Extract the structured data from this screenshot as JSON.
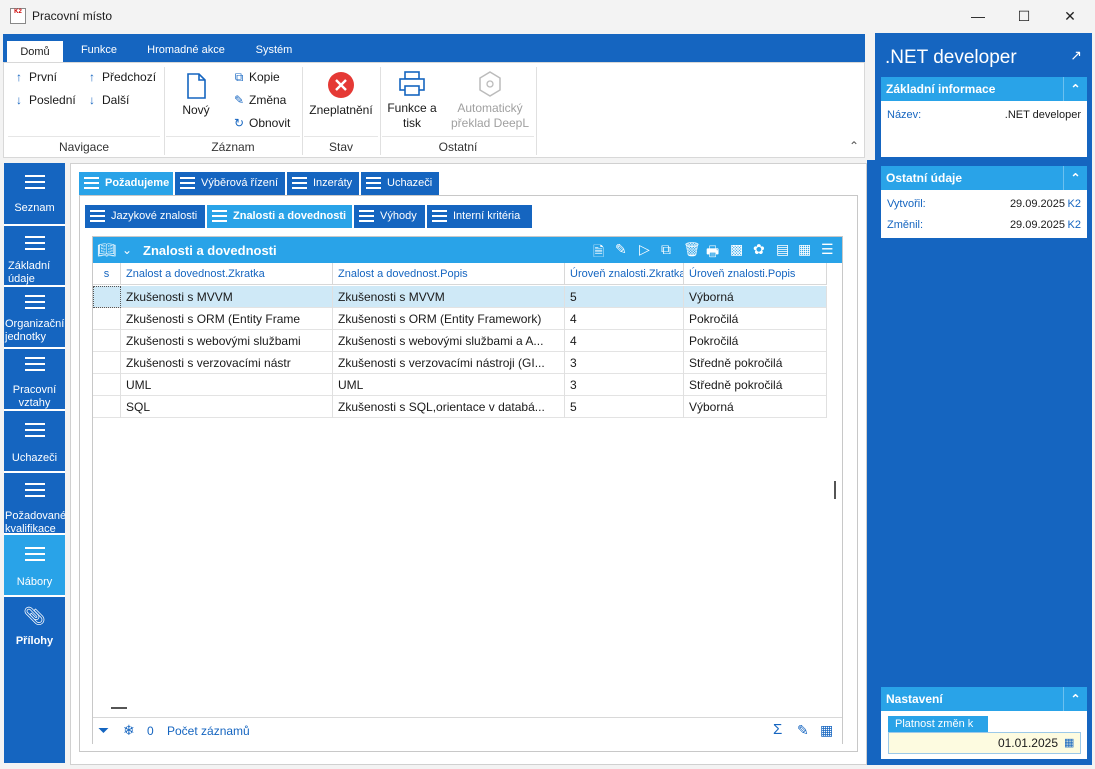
{
  "window": {
    "title": "Pracovní místo",
    "icon_text": "K2"
  },
  "ribbon": {
    "tabs": [
      "Domů",
      "Funkce",
      "Hromadné akce",
      "Systém"
    ],
    "nav": {
      "prvni": "První",
      "posledni": "Poslední",
      "predchozi": "Předchozí",
      "dalsi": "Další",
      "group": "Navigace"
    },
    "zaznam": {
      "novy": "Nový",
      "kopie": "Kopie",
      "zmena": "Změna",
      "obnovit": "Obnovit",
      "group": "Záznam"
    },
    "stav": {
      "zneplatneni": "Zneplatnění",
      "group": "Stav"
    },
    "ostatni": {
      "funkce_tisk_1": "Funkce a",
      "funkce_tisk_2": "tisk",
      "deepl_1": "Automatický",
      "deepl_2": "překlad DeepL",
      "group": "Ostatní"
    }
  },
  "leftnav": [
    {
      "label": "Seznam",
      "active": false
    },
    {
      "label": "Základní údaje",
      "active": false
    },
    {
      "label": "Organizační jednotky",
      "active": false
    },
    {
      "label": "Pracovní vztahy",
      "active": false
    },
    {
      "label": "Uchazeči",
      "active": false
    },
    {
      "label": "Požadované kvalifikace",
      "active": false
    },
    {
      "label": "Nábory",
      "active": true
    },
    {
      "label": "Přílohy",
      "active": false
    }
  ],
  "tabs_level1": [
    "Požadujeme",
    "Výběrová řízení",
    "Inzeráty",
    "Uchazeči"
  ],
  "tabs_level2": [
    "Jazykové znalosti",
    "Znalosti a dovednosti",
    "Výhody",
    "Interní kritéria"
  ],
  "grid": {
    "title": "Znalosti a dovednosti",
    "columns": [
      "s",
      "Znalost a dovednost.Zkratka",
      "Znalost a dovednost.Popis",
      "Úroveň znalosti.Zkratka",
      "Úroveň znalosti.Popis"
    ],
    "rows": [
      [
        "",
        "Zkušenosti s MVVM",
        "Zkušenosti s MVVM",
        "5",
        "Výborná"
      ],
      [
        "",
        "Zkušenosti s ORM (Entity Frame",
        "Zkušenosti s ORM (Entity Framework)",
        "4",
        "Pokročilá"
      ],
      [
        "",
        "Zkušenosti s webovými službami",
        "Zkušenosti s webovými službami a A...",
        "4",
        "Pokročilá"
      ],
      [
        "",
        "Zkušenosti s verzovacími nástr",
        "Zkušenosti s verzovacími nástroji (GI...",
        "3",
        "Středně pokročilá"
      ],
      [
        "",
        "UML",
        "UML",
        "3",
        "Středně pokročilá"
      ],
      [
        "",
        "SQL",
        "Zkušenosti s SQL,orientace v databá...",
        "5",
        "Výborná"
      ]
    ],
    "footer": {
      "count": "0",
      "count_label": "Počet záznamů"
    }
  },
  "right": {
    "title": ".NET developer",
    "basic": {
      "header": "Základní informace",
      "name_label": "Název:",
      "name_value": ".NET developer"
    },
    "other": {
      "header": "Ostatní údaje",
      "created_label": "Vytvořil:",
      "created_value": "29.09.2025",
      "created_user": "K2",
      "changed_label": "Změnil:",
      "changed_value": "29.09.2025",
      "changed_user": "K2"
    },
    "settings": {
      "header": "Nastavení",
      "validity_label": "Platnost změn k",
      "validity_value": "01.01.2025"
    }
  }
}
